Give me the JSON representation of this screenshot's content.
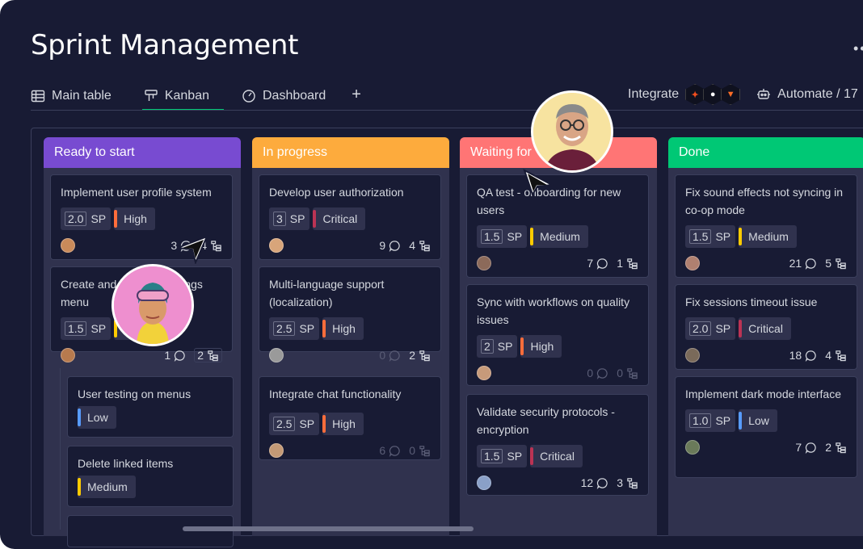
{
  "title": "Sprint Management",
  "menu": "••",
  "tabs": [
    {
      "label": "Main table",
      "icon": "table-icon"
    },
    {
      "label": "Kanban",
      "icon": "kanban-icon"
    },
    {
      "label": "Dashboard",
      "icon": "dashboard-icon"
    }
  ],
  "add_tab": "+",
  "integrate_label": "Integrate",
  "integrate_icons": [
    "figma-icon",
    "github-icon",
    "gitlab-icon"
  ],
  "automate_label": "Automate / 17",
  "columns": [
    {
      "name": "Ready to start",
      "color": "#784bd1",
      "cards": [
        {
          "title": "Implement user profile system",
          "sp": "2.0",
          "sp_unit": "SP",
          "priority": "High",
          "priority_color": "#ff6d3b",
          "comments": "3",
          "subitems": "4",
          "avatar_color": "#c98a5a"
        },
        {
          "title": "Create and manage settings menu",
          "sp": "1.5",
          "sp_unit": "SP",
          "priority": "",
          "priority_color": "#ffcb00",
          "comments": "1",
          "subitems": "2",
          "avatar_color": "#b77a4e"
        },
        {
          "title": "User testing on menus",
          "priority": "Low",
          "priority_color": "#579bfc"
        },
        {
          "title": "Delete linked items",
          "priority": "Medium",
          "priority_color": "#ffcb00"
        }
      ]
    },
    {
      "name": "In progress",
      "color": "#fdab3d",
      "cards": [
        {
          "title": "Develop user authorization",
          "sp": "3",
          "sp_unit": "SP",
          "priority": "Critical",
          "priority_color": "#bb3354",
          "comments": "9",
          "subitems": "4",
          "avatar_color": "#d8a57a"
        },
        {
          "title": "Multi-language support (localization)",
          "sp": "2.5",
          "sp_unit": "SP",
          "priority": "High",
          "priority_color": "#ff6d3b",
          "comments": "0",
          "subitems": "2",
          "avatar_color": "#9a9a9a"
        },
        {
          "title": "Integrate chat functionality",
          "sp": "2.5",
          "sp_unit": "SP",
          "priority": "High",
          "priority_color": "#ff6d3b",
          "comments": "6",
          "subitems": "0",
          "avatar_color": "#c49a76"
        }
      ]
    },
    {
      "name": "Waiting for",
      "color": "#ff7575",
      "cards": [
        {
          "title": "QA test - onboarding for new users",
          "sp": "1.5",
          "sp_unit": "SP",
          "priority": "Medium",
          "priority_color": "#ffcb00",
          "comments": "7",
          "subitems": "1",
          "avatar_color": "#8c6a5a"
        },
        {
          "title": "Sync with workflows on quality issues",
          "sp": "2",
          "sp_unit": "SP",
          "priority": "High",
          "priority_color": "#ff6d3b",
          "comments": "0",
          "subitems": "0",
          "avatar_color": "#c79a7a"
        },
        {
          "title": "Validate security protocols - encryption",
          "sp": "1.5",
          "sp_unit": "SP",
          "priority": "Critical",
          "priority_color": "#bb3354",
          "comments": "12",
          "subitems": "3",
          "avatar_color": "#8aa0c8"
        }
      ]
    },
    {
      "name": "Done",
      "color": "#00c875",
      "cards": [
        {
          "title": "Fix sound effects not syncing in co-op mode",
          "sp": "1.5",
          "sp_unit": "SP",
          "priority": "Medium",
          "priority_color": "#ffcb00",
          "comments": "21",
          "subitems": "5",
          "avatar_color": "#b08070"
        },
        {
          "title": "Fix sessions timeout issue",
          "sp": "2.0",
          "sp_unit": "SP",
          "priority": "Critical",
          "priority_color": "#bb3354",
          "comments": "18",
          "subitems": "4",
          "avatar_color": "#7a6a5a"
        },
        {
          "title": "Implement dark mode interface",
          "sp": "1.0",
          "sp_unit": "SP",
          "priority": "Low",
          "priority_color": "#579bfc",
          "comments": "7",
          "subitems": "2",
          "avatar_color": "#6a7a5a"
        }
      ]
    }
  ]
}
